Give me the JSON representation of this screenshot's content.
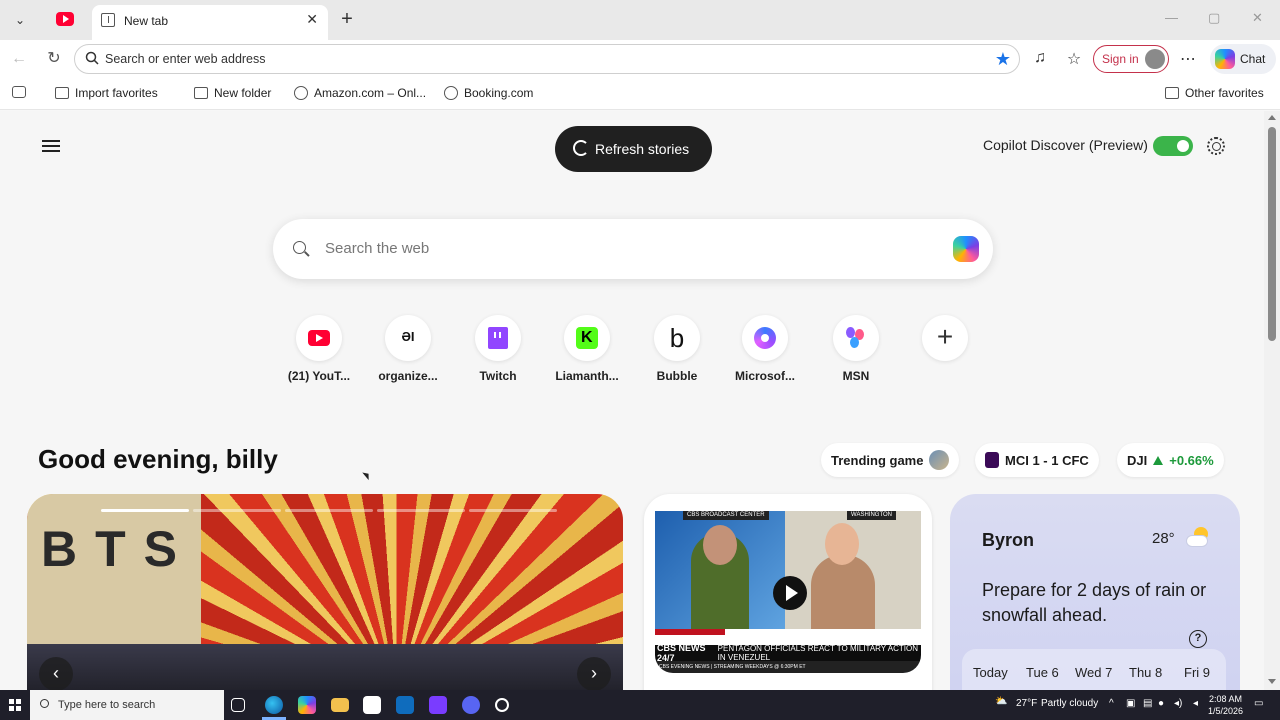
{
  "tabs": [
    {
      "name": "youtube-tab",
      "icon": "youtube-icon"
    },
    {
      "name": "new-tab",
      "title": "New tab",
      "active": true
    }
  ],
  "toolbar": {
    "address_placeholder": "Search or enter web address",
    "sign_in": "Sign in",
    "chat": "Chat"
  },
  "favorites": [
    {
      "label": "Import favorites",
      "icon": "import-icon"
    },
    {
      "label": "New folder",
      "icon": "folder-icon"
    },
    {
      "label": "Amazon.com – Onl...",
      "icon": "globe-icon"
    },
    {
      "label": "Booking.com",
      "icon": "globe-icon"
    }
  ],
  "other_favorites": "Other favorites",
  "header": {
    "refresh_label": "Refresh stories",
    "copilot_discover": "Copilot Discover (Preview)",
    "toggle_on": true
  },
  "search": {
    "placeholder": "Search the web"
  },
  "quick_links": [
    {
      "label": "(21) YouT...",
      "icon": "youtube-icon"
    },
    {
      "label": "organize...",
      "icon": "oi-icon"
    },
    {
      "label": "Twitch",
      "icon": "twitch-icon"
    },
    {
      "label": "Liamanth...",
      "icon": "kick-icon"
    },
    {
      "label": "Bubble",
      "icon": "bubble-icon"
    },
    {
      "label": "Microsof...",
      "icon": "microsoft-icon"
    },
    {
      "label": "MSN",
      "icon": "msn-icon"
    },
    {
      "label": "",
      "icon": "add-icon"
    }
  ],
  "greeting": "Good evening, billy",
  "pills": {
    "trending": "Trending game",
    "match": "MCI 1 - 1 CFC",
    "stock_symbol": "DJI",
    "stock_change": "+0.66%"
  },
  "hero": {
    "text": "BTS",
    "slides": 5,
    "current_slide": 1
  },
  "video": {
    "tag_left": "CBS BROADCAST CENTER",
    "tag_right": "WASHINGTON",
    "live": "LIVE",
    "network": "CBS NEWS 24/7",
    "headline": "PENTAGON OFFICIALS REACT TO MILITARY ACTION IN VENEZUEL",
    "bottom": "CBS EVENING NEWS | STREAMING WEEKDAYS @ 6:30PM ET"
  },
  "weather": {
    "city": "Byron",
    "temp": "28°",
    "description": "Prepare for 2 days of rain or snowfall ahead.",
    "days": [
      "Today",
      "Tue 6",
      "Wed 7",
      "Thu 8",
      "Fri 9"
    ]
  },
  "taskbar": {
    "search_placeholder": "Type here to search",
    "weather": "27°F",
    "weather_desc": "Partly cloudy",
    "time": "2:08 AM",
    "date": "1/5/2026"
  }
}
